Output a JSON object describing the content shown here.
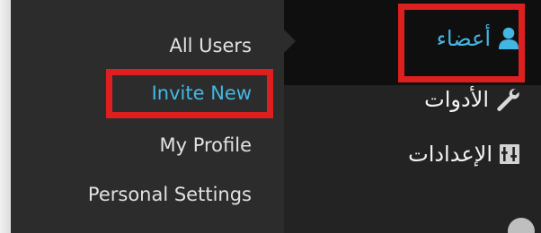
{
  "submenu": {
    "items": [
      {
        "label": "All Users"
      },
      {
        "label": "Invite New",
        "current": true
      },
      {
        "label": "My Profile"
      },
      {
        "label": "Personal Settings"
      }
    ]
  },
  "mainmenu": {
    "items": [
      {
        "label": "أعضاء",
        "icon": "users-icon",
        "current": true
      },
      {
        "label": "الأدوات",
        "icon": "wrench-icon"
      },
      {
        "label": "الإعدادات",
        "icon": "settings-sliders-icon"
      }
    ]
  },
  "colors": {
    "submenu_bg": "#2c2c2c",
    "mainmenu_bg": "#232323",
    "active_text": "#43b7e4",
    "highlight": "#de1f1f"
  }
}
